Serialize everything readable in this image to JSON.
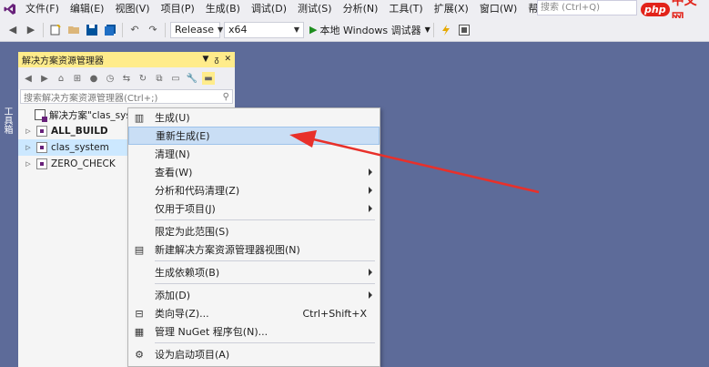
{
  "menubar": {
    "items": [
      "文件(F)",
      "编辑(E)",
      "视图(V)",
      "项目(P)",
      "生成(B)",
      "调试(D)",
      "测试(S)",
      "分析(N)",
      "工具(T)",
      "扩展(X)",
      "窗口(W)",
      "帮助(H)"
    ],
    "search_placeholder": "搜索 (Ctrl+Q)",
    "brand_badge": "php",
    "brand_text": "中文网"
  },
  "toolbar": {
    "configuration": "Release",
    "platform": "x64",
    "run_label": "本地 Windows 调试器"
  },
  "toolstrip": {
    "label": "工具箱"
  },
  "solution_explorer": {
    "title": "解决方案资源管理器",
    "search_placeholder": "搜索解决方案资源管理器(Ctrl+;)",
    "tree": [
      {
        "label": "解决方案\"clas_system",
        "expander": "",
        "bold": false
      },
      {
        "label": "ALL_BUILD",
        "expander": "▷",
        "bold": true
      },
      {
        "label": "clas_system",
        "expander": "▷",
        "bold": false
      },
      {
        "label": "ZERO_CHECK",
        "expander": "▷",
        "bold": false
      }
    ]
  },
  "context_menu": {
    "items": [
      {
        "label": "生成(U)",
        "icon": "build-icon",
        "shortcut": "",
        "submenu": false
      },
      {
        "label": "重新生成(E)",
        "icon": "",
        "shortcut": "",
        "submenu": false,
        "highlight": true
      },
      {
        "label": "清理(N)",
        "icon": "",
        "shortcut": "",
        "submenu": false
      },
      {
        "label": "查看(W)",
        "icon": "",
        "shortcut": "",
        "submenu": true
      },
      {
        "label": "分析和代码清理(Z)",
        "icon": "",
        "shortcut": "",
        "submenu": true
      },
      {
        "label": "仅用于项目(J)",
        "icon": "",
        "shortcut": "",
        "submenu": true
      },
      {
        "sep": true
      },
      {
        "label": "限定为此范围(S)",
        "icon": "",
        "shortcut": "",
        "submenu": false
      },
      {
        "label": "新建解决方案资源管理器视图(N)",
        "icon": "new-view-icon",
        "shortcut": "",
        "submenu": false
      },
      {
        "sep": true
      },
      {
        "label": "生成依赖项(B)",
        "icon": "",
        "shortcut": "",
        "submenu": true
      },
      {
        "sep": true
      },
      {
        "label": "添加(D)",
        "icon": "",
        "shortcut": "",
        "submenu": true
      },
      {
        "label": "类向导(Z)...",
        "icon": "class-wizard-icon",
        "shortcut": "Ctrl+Shift+X",
        "submenu": false
      },
      {
        "label": "管理 NuGet 程序包(N)...",
        "icon": "nuget-icon",
        "shortcut": "",
        "submenu": false
      },
      {
        "sep": true
      },
      {
        "label": "设为启动项目(A)",
        "icon": "gear-icon",
        "shortcut": "",
        "submenu": false
      }
    ]
  },
  "colors": {
    "annotation_arrow": "#e8302a",
    "title_highlight": "#ffec8b",
    "selection": "#c9def5",
    "background": "#5d6b99"
  }
}
